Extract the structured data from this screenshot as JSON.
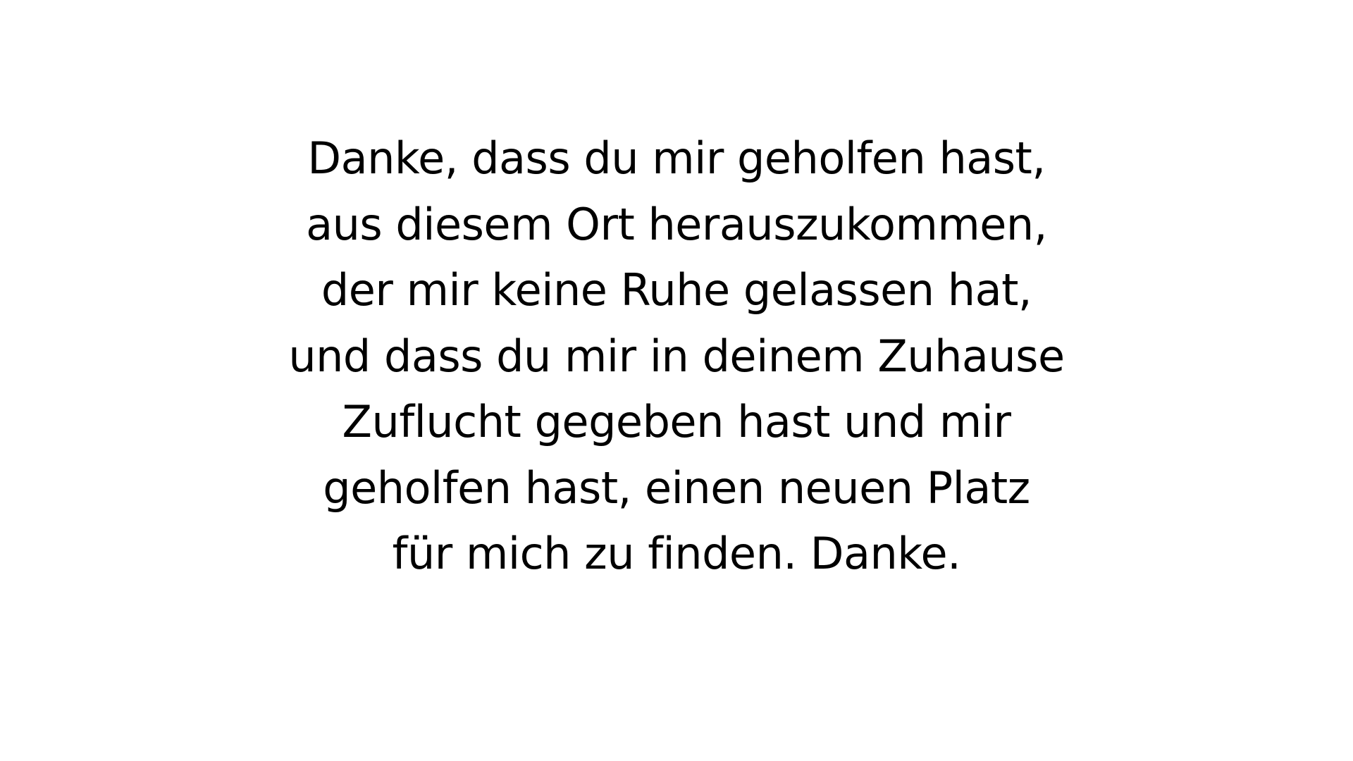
{
  "colors": {
    "background": "#ffffff",
    "text": "#000000"
  },
  "message": {
    "lines": [
      "Danke, dass du mir geholfen hast,",
      "aus diesem Ort herauszukommen,",
      "der mir keine Ruhe gelassen hat,",
      "und dass du mir in deinem Zuhause",
      "Zuflucht gegeben hast und mir",
      "geholfen hast, einen neuen Platz",
      "für mich zu finden. Danke."
    ]
  }
}
